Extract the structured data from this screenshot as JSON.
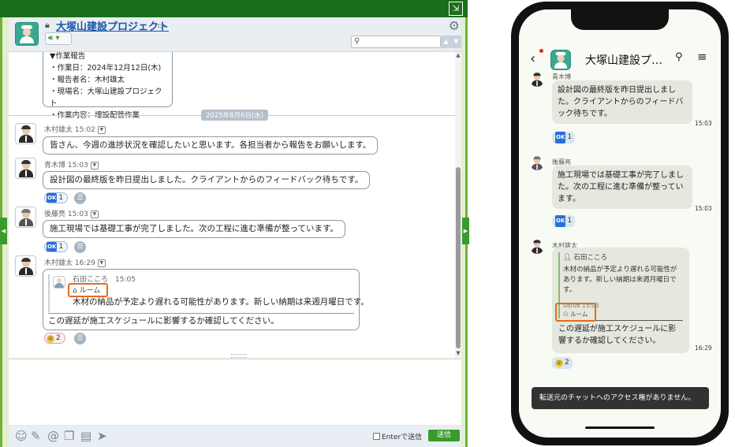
{
  "desktop": {
    "title": "大塚山建設プロジェクト",
    "search_placeholder": "",
    "partial_message": [
      "▼作業報告",
      "・作業日：2024年12月12日(木)",
      "・報告者名：木村雄太",
      "・現場名：大塚山建設プロジェクト",
      "・作業内容：埋設配管作業"
    ],
    "date_separator": "2025年8月6日(水)",
    "messages": [
      {
        "author": "木村雄太",
        "time": "15:02",
        "text": "皆さん、今週の進捗状況を確認したいと思います。各担当者から報告をお願いします。"
      },
      {
        "author": "青木博",
        "time": "15:03",
        "text": "設計図の最終版を昨日提出しました。クライアントからのフィードバック待ちです。",
        "reaction_count": "1"
      },
      {
        "author": "後藤亮",
        "time": "15:03",
        "text": "施工現場では基礎工事が完了しました。次の工程に進む準備が整っています。",
        "reaction_count": "1"
      },
      {
        "author": "木村雄太",
        "time": "16:29",
        "quote_author": "石田こころ",
        "quote_time": "15:05",
        "quote_room": "ルーム",
        "quote_text": "木材の納品が予定より遅れる可能性があります。新しい納期は来週月曜日です。",
        "text": "この遅延が施工スケジュールに影響するか確認してください。",
        "reaction_count": "2"
      }
    ],
    "enter_label": "Enterで送信",
    "send_label": "送信",
    "reaction_ok": "OK"
  },
  "mobile": {
    "title": "大塚山建設プ…",
    "messages": [
      {
        "author": "青木博",
        "text": "設計図の最終版を昨日提出しました。クライアントからのフィードバック待ちです。",
        "time": "15:03",
        "reaction_count": "1"
      },
      {
        "author": "後藤亮",
        "text": "施工現場では基礎工事が完了しました。次の工程に進む準備が整っています。",
        "time": "15:03",
        "reaction_count": "1"
      },
      {
        "author": "木村雄太",
        "quote_author": "石田こころ",
        "quote_text": "木材の納品が予定より遅れる可能性があります。新しい納期は来週月曜日です。",
        "quote_meta": "08/06 15:05",
        "quote_room": "ルーム",
        "text": "この遅延が施工スケジュールに影響するか確認してください。",
        "time": "16:29",
        "reaction_count": "2"
      }
    ],
    "toast": "転送元のチャットへのアクセス権がありません。"
  },
  "colors": {
    "accent": "#3a9b2c",
    "header_bar": "#1a6e1a",
    "link": "#1a55a8",
    "highlight": "#e36c1c"
  }
}
